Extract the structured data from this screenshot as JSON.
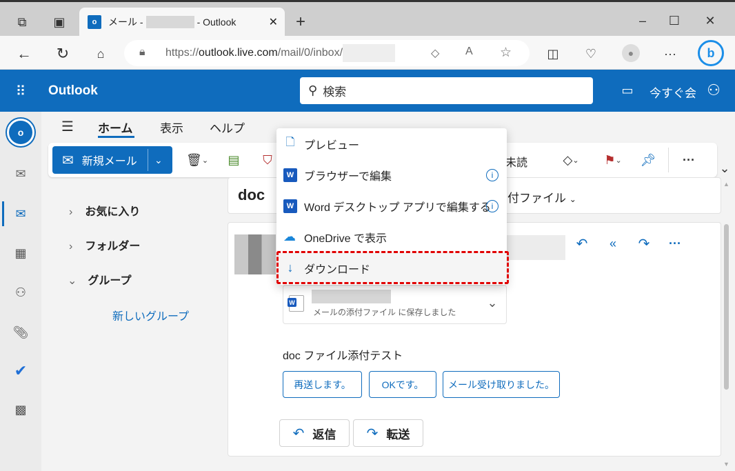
{
  "browser": {
    "tab_title_prefix": "メール -",
    "tab_title_suffix": "- Outlook",
    "url_prefix": "https://",
    "url_host": "outlook.live.com",
    "url_path": "/mail/0/inbox/"
  },
  "header": {
    "app_name": "Outlook",
    "search_placeholder": "検索",
    "meet_now": "今すぐ会"
  },
  "menu_tabs": [
    "ホーム",
    "表示",
    "ヘルプ"
  ],
  "toolbar": {
    "new_mail": "新規メール",
    "unread": "未読"
  },
  "folders": {
    "favorites": "お気に入り",
    "folders": "フォルダー",
    "groups": "グループ",
    "new_group": "新しいグループ"
  },
  "subject": {
    "prefix": "doc",
    "suffix": "付ファイル"
  },
  "context_menu": {
    "items": [
      "プレビュー",
      "ブラウザーで編集",
      "Word デスクトップ アプリで編集する",
      "OneDrive で表示",
      "ダウンロード"
    ]
  },
  "attachment": {
    "status": "メールの添付ファイル に保存しました"
  },
  "message": {
    "body": "doc ファイル添付テスト",
    "quick_replies": [
      "再送します。",
      "OKです。",
      "メール受け取りました。"
    ],
    "reply": "返信",
    "forward": "転送"
  },
  "colors": {
    "brand": "#0f6cbd",
    "highlight": "#e00000"
  }
}
